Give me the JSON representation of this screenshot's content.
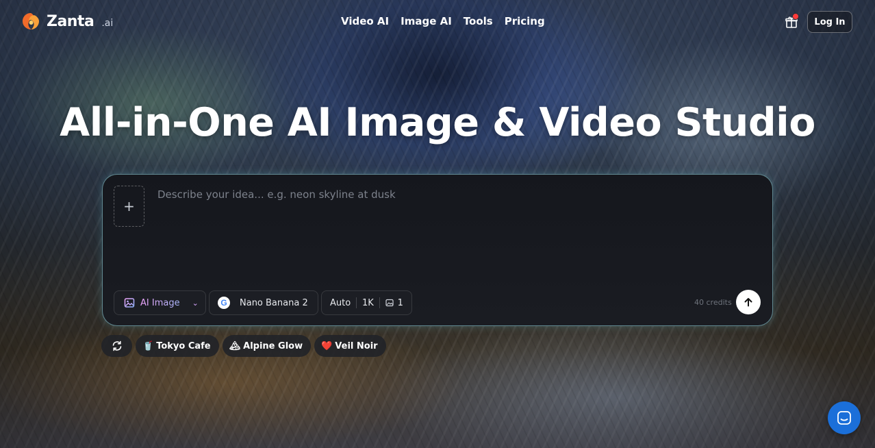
{
  "brand": {
    "name": "Zanta",
    "suffix": ".ai"
  },
  "nav": {
    "items": [
      "Video AI",
      "Image AI",
      "Tools",
      "Pricing"
    ]
  },
  "header": {
    "login_label": "Log In",
    "gift_icon": "gift-icon",
    "notification_color": "#ff3b3b"
  },
  "hero": {
    "title": "All-in-One AI Image & Video Studio"
  },
  "prompt": {
    "placeholder": "Describe your idea... e.g. neon skyline at dusk",
    "value": "",
    "upload_icon": "plus-icon"
  },
  "controls": {
    "mode": "AI Image",
    "model": "Nano Banana 2",
    "model_icon": "G",
    "aspect": "Auto",
    "resolution": "1K",
    "image_count": "1",
    "credits": "40 credits"
  },
  "suggestions": [
    {
      "emoji": "🥤",
      "label": "Tokyo Cafe"
    },
    {
      "emoji": "🏔",
      "label": "Alpine Glow"
    },
    {
      "emoji": "❤️",
      "label": "Veil Noir"
    }
  ],
  "colors": {
    "accent_border": "#a0e6f0",
    "support": "#1b6fd9",
    "card_bg": "#15171d"
  }
}
